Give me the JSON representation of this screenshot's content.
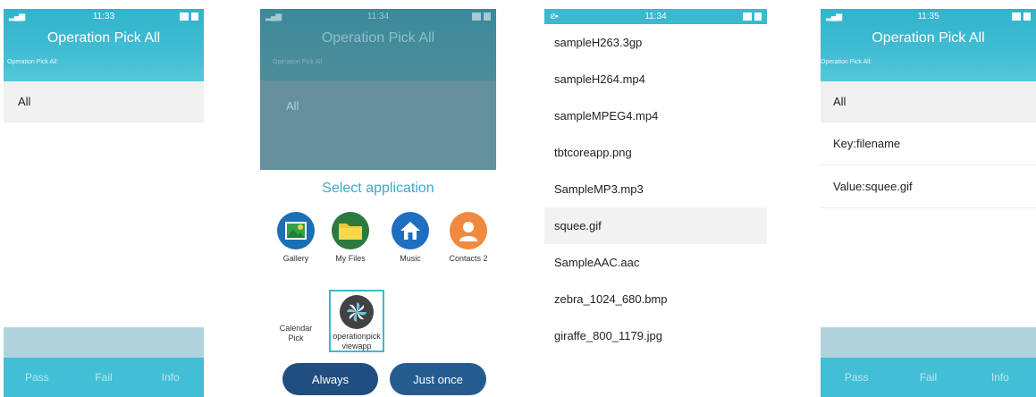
{
  "screen1": {
    "time": "11:33",
    "title": "Operation Pick All",
    "subtitle": "Operation Pick All:",
    "list": [
      "All"
    ],
    "bottom": [
      "Pass",
      "Fail",
      "Info"
    ]
  },
  "screen2": {
    "time": "11:34",
    "title": "Operation Pick All",
    "subtitle": "Operation Pick All:",
    "list_item": "All",
    "sheet_title": "Select application",
    "apps": [
      {
        "label": "Gallery",
        "icon": "gallery-icon"
      },
      {
        "label": "My Files",
        "icon": "folder-icon"
      },
      {
        "label": "Music",
        "icon": "music-home-icon"
      },
      {
        "label": "Contacts 2",
        "icon": "contacts-icon"
      },
      {
        "label": "Calendar Pick",
        "icon": "calendar-icon"
      },
      {
        "label": "operationpickviewapp",
        "icon": "pinwheel-icon",
        "selected": true
      }
    ],
    "always_label": "Always",
    "once_label": "Just once"
  },
  "screen3": {
    "time": "11:34",
    "files": [
      "sampleH263.3gp",
      "sampleH264.mp4",
      "sampleMPEG4.mp4",
      "tbtcoreapp.png",
      "SampleMP3.mp3",
      "squee.gif",
      "SampleAAC.aac",
      "zebra_1024_680.bmp",
      "giraffe_800_1179.jpg"
    ],
    "highlighted": "squee.gif"
  },
  "screen4": {
    "time": "11:35",
    "title": "Operation Pick All",
    "subtitle": "Operation Pick All:",
    "list": [
      "All",
      "Key:filename",
      "Value:squee.gif"
    ],
    "bottom": [
      "Pass",
      "Fail",
      "Info"
    ]
  },
  "colors": {
    "header": "#40bdd3",
    "bottom_bar": "#43bfd5",
    "button": "#1f4f80",
    "selection": "#3fb8d0"
  }
}
